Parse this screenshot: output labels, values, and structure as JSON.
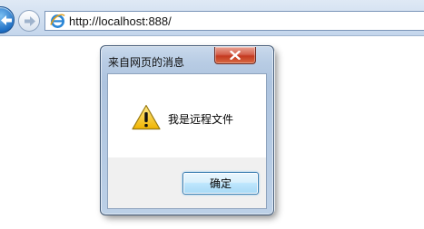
{
  "browser": {
    "address": "http://localhost:888/",
    "icons": {
      "back": "back-arrow-icon",
      "forward": "forward-arrow-icon",
      "page": "internet-explorer-icon"
    }
  },
  "dialog": {
    "title": "来自网页的消息",
    "message": "我是远程文件",
    "ok_label": "确定",
    "icons": {
      "close": "close-icon",
      "warning": "warning-icon"
    },
    "colors": {
      "close_button": "#c4391f",
      "frame": "#b8cce4",
      "warning": "#f5c400"
    }
  }
}
